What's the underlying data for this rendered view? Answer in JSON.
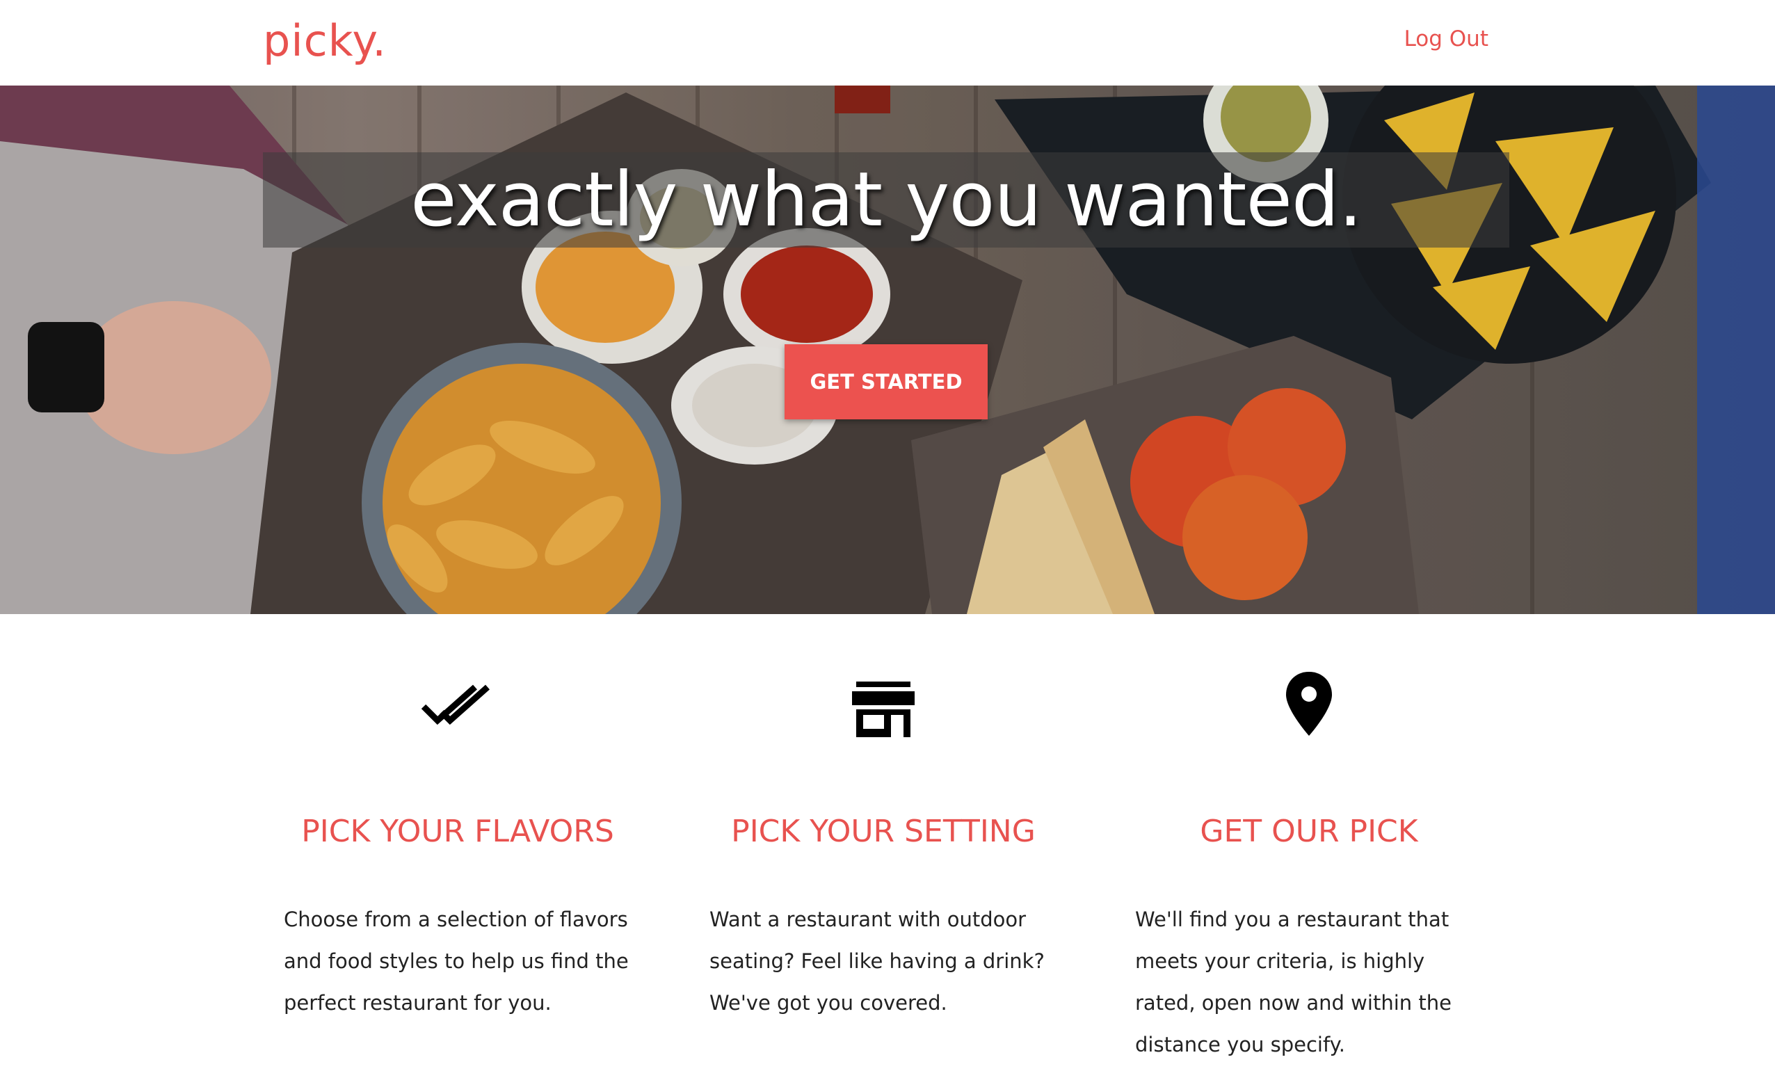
{
  "nav": {
    "brand": "picky.",
    "logout_label": "Log Out"
  },
  "hero": {
    "title": "exactly what you wanted.",
    "cta_label": "GET STARTED"
  },
  "features": [
    {
      "icon": "double-check-icon",
      "title": "PICK YOUR FLAVORS",
      "text": "Choose from a selection of flavors and food styles to help us find the perfect restaurant for you."
    },
    {
      "icon": "storefront-icon",
      "title": "PICK YOUR SETTING",
      "text": "Want a restaurant with outdoor seating? Feel like having a drink? We've got you covered."
    },
    {
      "icon": "map-pin-icon",
      "title": "GET OUR PICK",
      "text": "We'll find you a restaurant that meets your criteria, is highly rated, open now and within the distance you specify."
    }
  ],
  "colors": {
    "accent": "#e8524f",
    "button": "#ec524f"
  }
}
